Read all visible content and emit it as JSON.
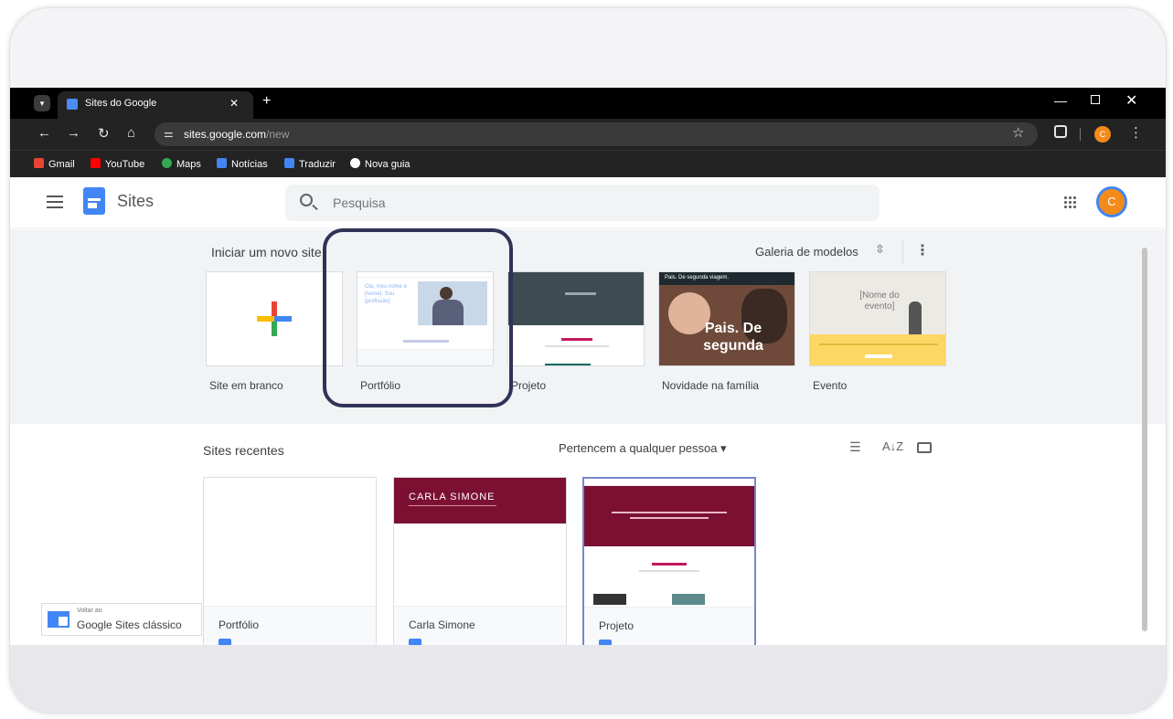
{
  "browser": {
    "tab_title": "Sites do Google",
    "url_host": "sites.google.com",
    "url_path": "/new",
    "profile_initial": "C",
    "bookmarks": [
      {
        "label": "Gmail",
        "color": "#ea4335"
      },
      {
        "label": "YouTube",
        "color": "#ff0000"
      },
      {
        "label": "Maps",
        "color": "#34a853"
      },
      {
        "label": "Notícias",
        "color": "#4285f4"
      },
      {
        "label": "Traduzir",
        "color": "#4285f4"
      },
      {
        "label": "Nova guia",
        "color": "#ffffff"
      }
    ]
  },
  "app": {
    "title": "Sites",
    "search_placeholder": "Pesquisa",
    "avatar_initial": "C"
  },
  "templates": {
    "section_label": "Iniciar um novo site",
    "gallery_label": "Galeria de modelos",
    "items": [
      {
        "label": "Site em branco"
      },
      {
        "label": "Portfólio",
        "thumb_text": "Olá, meu nome é [nome]. Sou [profissão]"
      },
      {
        "label": "Projeto"
      },
      {
        "label": "Novidade na família",
        "thumb_header": "Pais. De segunda viagem.",
        "thumb_title": "Pais. De segunda"
      },
      {
        "label": "Evento",
        "thumb_text": "[Nome do evento]"
      }
    ]
  },
  "recent": {
    "section_label": "Sites recentes",
    "owner_filter": "Pertencem a qualquer pessoa ▾",
    "items": [
      {
        "name": "Portfólio"
      },
      {
        "name": "Carla Simone",
        "banner": "CARLA SIMONE"
      },
      {
        "name": "Projeto"
      }
    ]
  },
  "classic_banner": {
    "small": "Voltar ao",
    "text": "Google Sites clássico"
  },
  "colors": {
    "accent": "#4285f4",
    "maroon": "#7b1032",
    "highlight_ring": "#2f3358",
    "event_yellow": "#fdd663"
  }
}
